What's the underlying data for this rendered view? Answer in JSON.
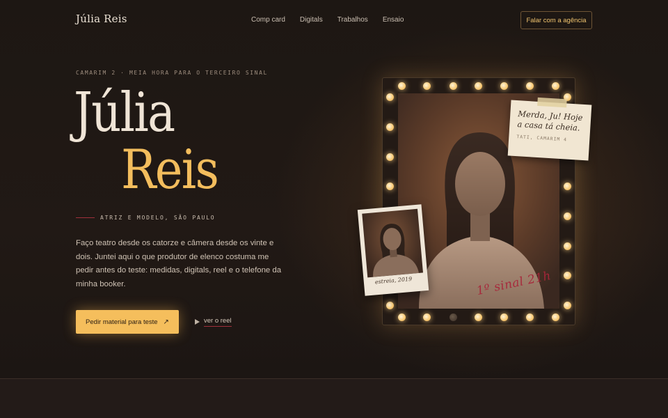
{
  "brand": "Júlia Reis",
  "nav": {
    "items": [
      "Comp card",
      "Digitals",
      "Trabalhos",
      "Ensaio"
    ],
    "agency_button": "Falar com a agência"
  },
  "hero": {
    "eyebrow": "CAMARIM 2 · MEIA HORA PARA O TERCEIRO SINAL",
    "first_name": "Júlia",
    "last_name": "Reis",
    "role": "ATRIZ E MODELO, SÃO PAULO",
    "intro": "Faço teatro desde os catorze e câmera desde os vinte e dois. Juntei aqui o que produtor de elenco costuma me pedir antes do teste: medidas, digitals, reel e o telefone da minha booker.",
    "cta_label": "Pedir material para teste",
    "cta_icon": "arrow-up-right-icon",
    "reel_label": "ver o reel"
  },
  "mirror": {
    "note_text": "Merda, Ju! Hoje a casa tá cheia.",
    "note_signature": "TATI, CAMARIM 4",
    "polaroid_caption": "estreia, 2019",
    "lipstick_text": "1º sinal 21h"
  },
  "colors": {
    "accent": "#f5be5c",
    "background": "#1b1512",
    "wine": "#a0303c"
  }
}
